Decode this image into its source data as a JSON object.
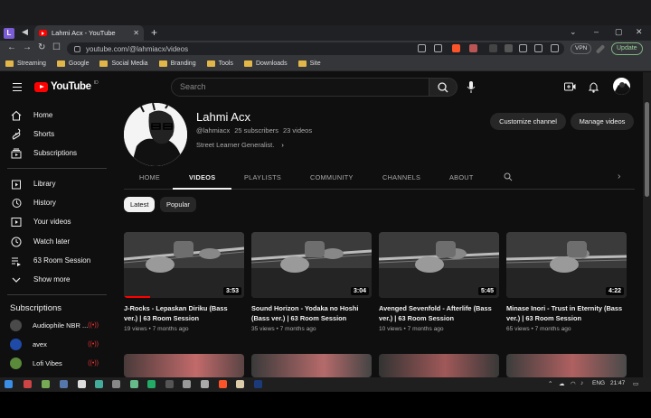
{
  "browser": {
    "profile_initial": "L",
    "tab_title": "Lahmi Acx - YouTube",
    "url": "youtube.com/@lahmiacx/videos",
    "vpn_label": "VPN",
    "update_label": "Update",
    "bookmarks": [
      "Streaming",
      "Google",
      "Social Media",
      "Branding",
      "Tools",
      "Downloads",
      "Site"
    ]
  },
  "header": {
    "logo_text": "YouTube",
    "logo_country": "ID",
    "search_placeholder": "Search"
  },
  "sidebar": {
    "main_items": [
      {
        "label": "Home",
        "icon": "home-icon"
      },
      {
        "label": "Shorts",
        "icon": "shorts-icon"
      },
      {
        "label": "Subscriptions",
        "icon": "subscriptions-icon"
      }
    ],
    "library_items": [
      {
        "label": "Library",
        "icon": "library-icon"
      },
      {
        "label": "History",
        "icon": "history-icon"
      },
      {
        "label": "Your videos",
        "icon": "your-videos-icon"
      },
      {
        "label": "Watch later",
        "icon": "watch-later-icon"
      },
      {
        "label": "63 Room Session",
        "icon": "playlist-icon"
      },
      {
        "label": "Show more",
        "icon": "chevron-down-icon"
      }
    ],
    "subscriptions_heading": "Subscriptions",
    "subscriptions": [
      {
        "name": "Audiophile NBR ...",
        "live": true,
        "color": "#4a4a4a"
      },
      {
        "name": "avex",
        "live": true,
        "color": "#1f4aa8"
      },
      {
        "name": "Lofi Vibes",
        "live": true,
        "color": "#5a8a3a"
      }
    ]
  },
  "channel": {
    "name": "Lahmi Acx",
    "handle": "@lahmiacx",
    "subscribers": "25 subscribers",
    "videos": "23 videos",
    "description": "Street Learner Generalist.",
    "customize_label": "Customize channel",
    "manage_label": "Manage videos",
    "tabs": [
      "HOME",
      "VIDEOS",
      "PLAYLISTS",
      "COMMUNITY",
      "CHANNELS",
      "ABOUT"
    ],
    "active_tab": "VIDEOS"
  },
  "filters": {
    "latest": "Latest",
    "popular": "Popular"
  },
  "videos": [
    {
      "title_line1": "J-Rocks - Lepaskan Diriku (Bass",
      "title_line2": "ver.) | 63 Room Session",
      "views": "19 views",
      "age": "7 months ago",
      "duration": "3:53",
      "watched": 0.22
    },
    {
      "title_line1": "Sound Horizon - Yodaka no Hoshi",
      "title_line2": "(Bass ver.) | 63 Room Session",
      "views": "35 views",
      "age": "7 months ago",
      "duration": "3:04",
      "watched": 0
    },
    {
      "title_line1": "Avenged Sevenfold - Afterlife (Bass",
      "title_line2": "ver.) | 63 Room Session",
      "views": "10 views",
      "age": "7 months ago",
      "duration": "5:45",
      "watched": 0
    },
    {
      "title_line1": "Minase Inori - Trust in Eternity (Bass",
      "title_line2": "ver.) | 63 Room Session",
      "views": "65 views",
      "age": "7 months ago",
      "duration": "4:22",
      "watched": 0
    }
  ],
  "taskbar": {
    "language": "ENG",
    "time": "21:47"
  },
  "colors": {
    "background": "#0f0f0f",
    "accent_red": "#ff0000",
    "chip_active_bg": "#f1f1f1",
    "button_bg": "#272727"
  }
}
